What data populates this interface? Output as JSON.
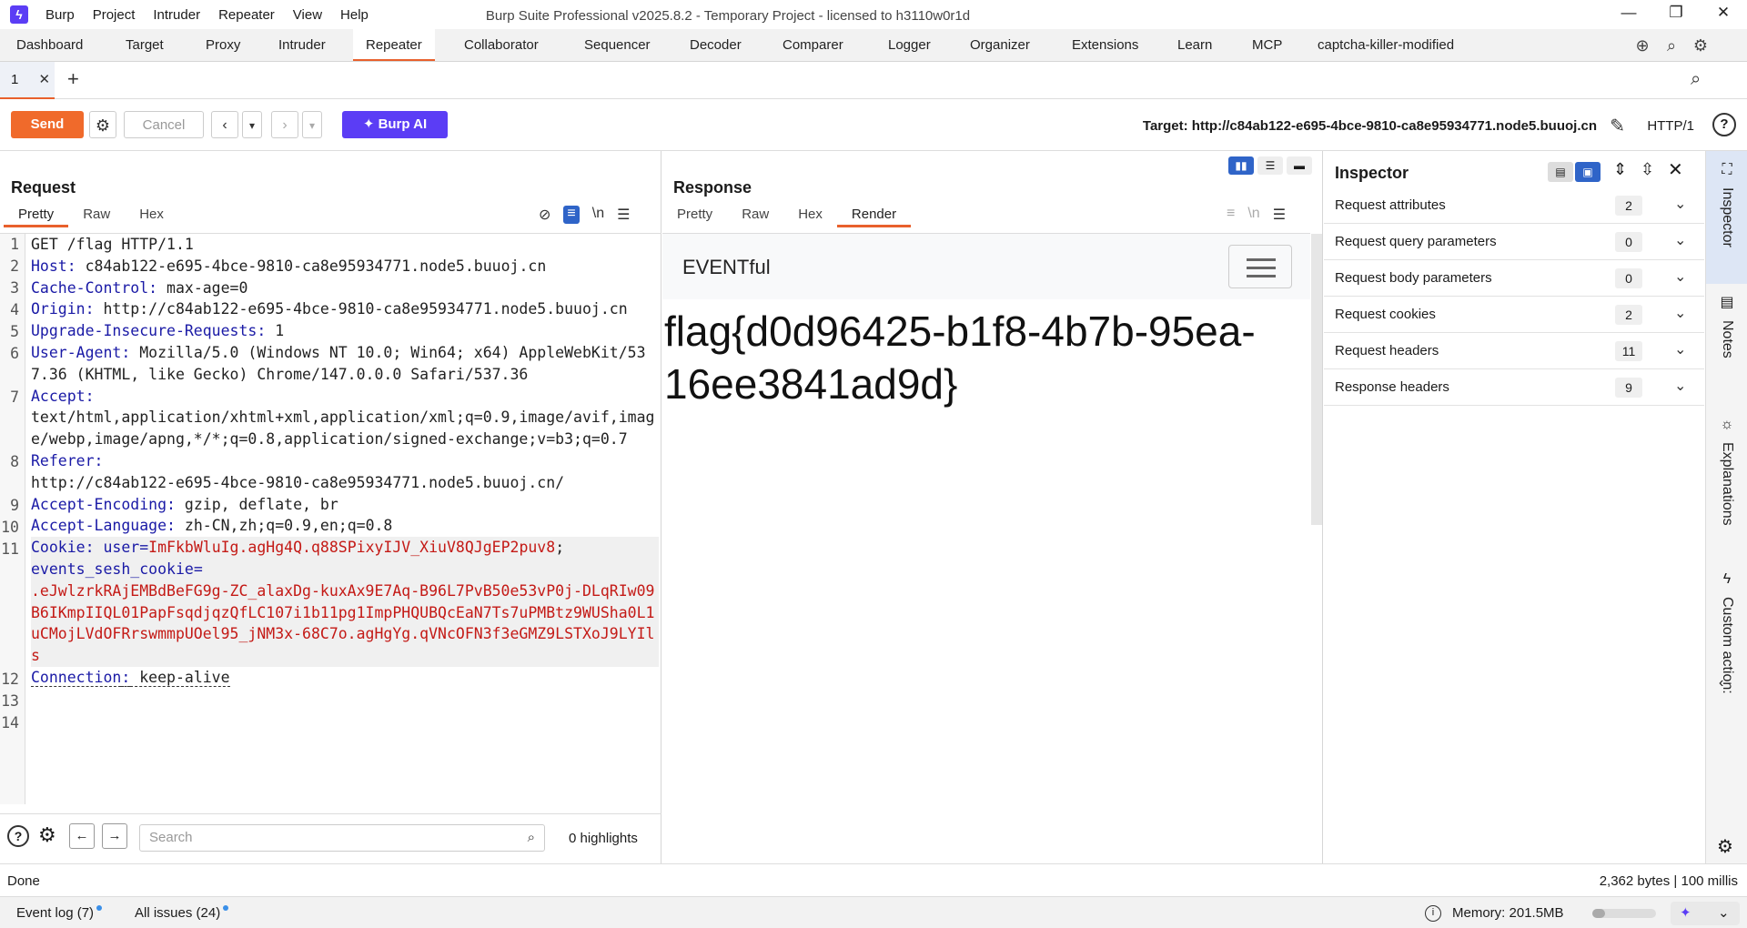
{
  "app": {
    "title": "Burp Suite Professional v2025.8.2 - Temporary Project - licensed to h3110w0r1d",
    "menu": [
      "Burp",
      "Project",
      "Intruder",
      "Repeater",
      "View",
      "Help"
    ]
  },
  "tabs": [
    "Dashboard",
    "Target",
    "Proxy",
    "Intruder",
    "Repeater",
    "Collaborator",
    "Sequencer",
    "Decoder",
    "Comparer",
    "Logger",
    "Organizer",
    "Extensions",
    "Learn",
    "MCP",
    "captcha-killer-modified"
  ],
  "subtab": {
    "label": "1",
    "close": "✕",
    "add": "+"
  },
  "toolbar": {
    "send": "Send",
    "cancel": "Cancel",
    "burp_ai": "Burp AI",
    "target": "Target: http://c84ab122-e695-4bce-9810-ca8e95934771.node5.buuoj.cn",
    "protocol": "HTTP/1"
  },
  "request": {
    "title": "Request",
    "views": [
      "Pretty",
      "Raw",
      "Hex"
    ],
    "wrap": "\\n",
    "lines": [
      {
        "n": "1",
        "k": "",
        "v": "GET /flag HTTP/1.1"
      },
      {
        "n": "2",
        "k": "Host",
        "v": " c84ab122-e695-4bce-9810-ca8e95934771.node5.buuoj.cn"
      },
      {
        "n": "3",
        "k": "Cache-Control",
        "v": " max-age=0"
      },
      {
        "n": "4",
        "k": "Origin",
        "v": " http://c84ab122-e695-4bce-9810-ca8e95934771.node5.buuoj.cn"
      },
      {
        "n": "5",
        "k": "Upgrade-Insecure-Requests",
        "v": " 1"
      },
      {
        "n": "6",
        "k": "User-Agent",
        "v": " Mozilla/5.0 (Windows NT 10.0; Win64; x64) AppleWebKit/537.36 (KHTML, like Gecko) Chrome/147.0.0.0 Safari/537.36"
      },
      {
        "n": "7",
        "k": "Accept",
        "v": "\ntext/html,application/xhtml+xml,application/xml;q=0.9,image/avif,image/webp,image/apng,*/*;q=0.8,application/signed-exchange;v=b3;q=0.7"
      },
      {
        "n": "8",
        "k": "Referer",
        "v": "\nhttp://c84ab122-e695-4bce-9810-ca8e95934771.node5.buuoj.cn/"
      },
      {
        "n": "9",
        "k": "Accept-Encoding",
        "v": " gzip, deflate, br"
      },
      {
        "n": "10",
        "k": "Accept-Language",
        "v": " zh-CN,zh;q=0.9,en;q=0.8"
      }
    ],
    "cookie": {
      "n": "11",
      "k": "Cookie",
      "name1": " user",
      "val1": "ImFkbWluIg.agHg4Q.q88SPixyIJV_XiuV8QJgEP2puv8",
      "name2": "events_sesh_cookie",
      "val2": ".eJwlzrkRAjEMBdBeFG9g-ZC_alaxDg-kuxAx9E7Aq-B96L7PvB50e53vP0j-DLqRIw09B6IKmpIIQL01PapFsqdjqzQfLC107i1b11pg1ImpPHQUBQcEaN7Ts7uPMBtz9WUSha0L1uCMojLVdOFRrswmmpUOel95_jNM3x-68C7o.agHgYg.qVNcOFN3f3eGMZ9LSTXoJ9LYIls"
    },
    "connection": {
      "n": "12",
      "k": "Connection",
      "v": " keep-alive"
    },
    "empty": [
      "13",
      "14"
    ],
    "search_placeholder": "Search",
    "highlights": "0 highlights"
  },
  "response": {
    "title": "Response",
    "views": [
      "Pretty",
      "Raw",
      "Hex",
      "Render"
    ],
    "wrap": "\\n",
    "brand": "EVENTful",
    "flag": "flag{d0d96425-b1f8-4b7b-95ea-16ee3841ad9d}"
  },
  "inspector": {
    "title": "Inspector",
    "rows": [
      {
        "label": "Request attributes",
        "count": "2"
      },
      {
        "label": "Request query parameters",
        "count": "0"
      },
      {
        "label": "Request body parameters",
        "count": "0"
      },
      {
        "label": "Request cookies",
        "count": "2"
      },
      {
        "label": "Request headers",
        "count": "11"
      },
      {
        "label": "Response headers",
        "count": "9"
      }
    ]
  },
  "sidebar": [
    "Inspector",
    "Notes",
    "Explanations",
    "Custom action:"
  ],
  "status": {
    "left": "Done",
    "right": "2,362 bytes | 100 millis"
  },
  "bottom": {
    "event_log": "Event log (7)",
    "issues": "All issues (24)",
    "memory": "Memory: 201.5MB"
  },
  "colors": {
    "accent": "#e8602c",
    "send": "#f06a2b",
    "ai": "#5b3df5",
    "header_key": "#1a1aa6",
    "cookie_value": "#c41a16"
  }
}
